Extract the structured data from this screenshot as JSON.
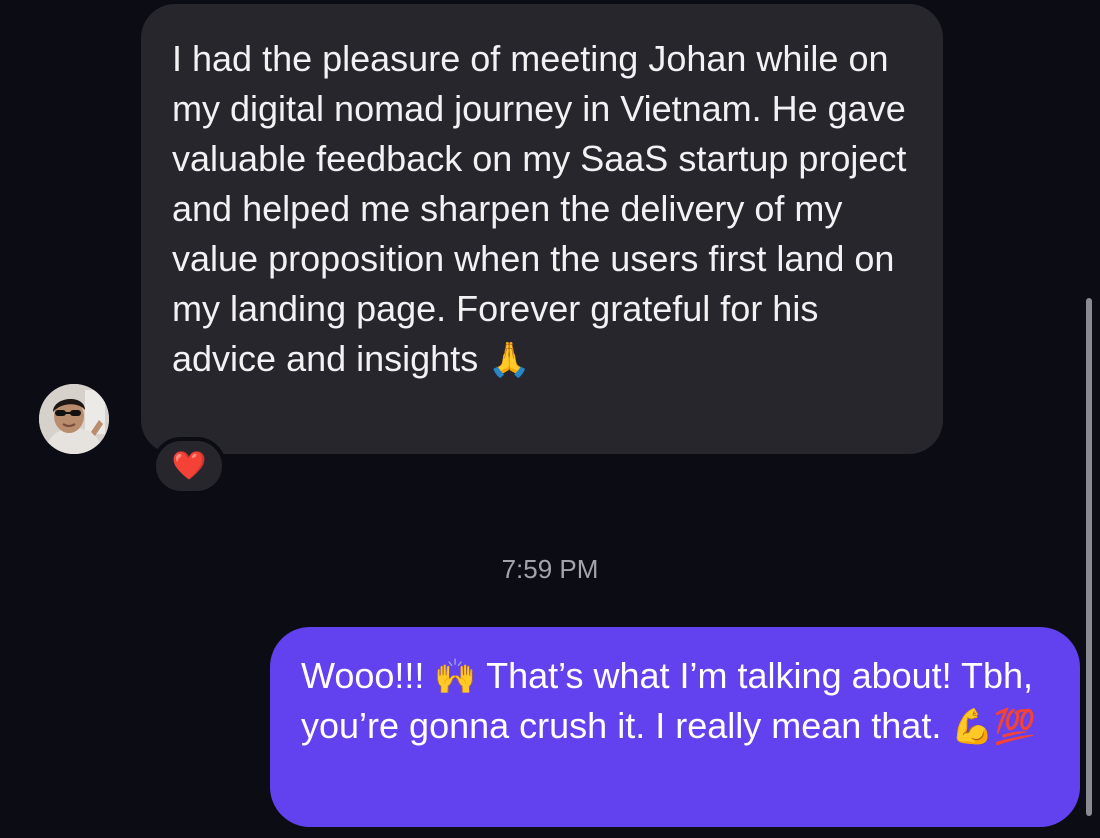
{
  "messages": {
    "incoming": {
      "text": "I had the pleasure of meeting Johan while on my digital nomad journey in Vietnam. He gave valuable feedback on my SaaS startup project and helped me sharpen the delivery of my value proposition when the users first land on my landing page. Forever grateful for his advice and insights",
      "emoji": "🙏",
      "reaction": "❤️",
      "avatar_icon": "user-avatar-icon"
    },
    "timestamp": "7:59 PM",
    "outgoing": {
      "part1": "Wooo!!! ",
      "emoji1": "🙌",
      "part2": " That’s what I’m talking about! Tbh, you’re gonna crush it. I really mean that. ",
      "emoji2": "💪",
      "emoji3": "💯"
    }
  },
  "colors": {
    "background": "#0c0c14",
    "incoming_bubble": "#26262c",
    "outgoing_bubble": "#6242ee",
    "timestamp": "#a3a3ab"
  }
}
